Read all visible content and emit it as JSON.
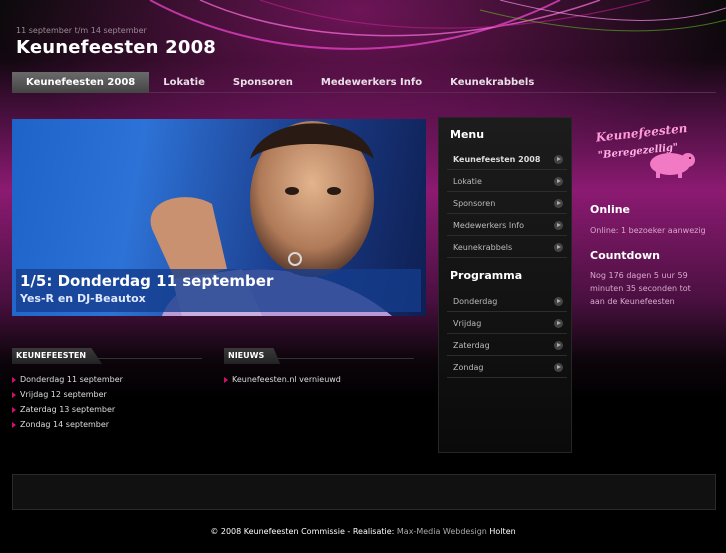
{
  "header": {
    "date_range": "11 september t/m 14 september",
    "title": "Keunefeesten 2008"
  },
  "nav": {
    "tabs": [
      {
        "label": "Keunefeesten 2008",
        "active": true
      },
      {
        "label": "Lokatie"
      },
      {
        "label": "Sponsoren"
      },
      {
        "label": "Medewerkers Info"
      },
      {
        "label": "Keunekrabbels"
      }
    ]
  },
  "hero": {
    "title": "1/5: Donderdag 11 september",
    "subtitle": "Yes-R en DJ-Beautox"
  },
  "menu_panel": {
    "menu_title": "Menu",
    "menu_items": [
      "Keunefeesten 2008",
      "Lokatie",
      "Sponsoren",
      "Medewerkers Info",
      "Keunekrabbels"
    ],
    "program_title": "Programma",
    "program_items": [
      "Donderdag",
      "Vrijdag",
      "Zaterdag",
      "Zondag"
    ]
  },
  "sidebar": {
    "logo_line1": "Keunefeesten",
    "logo_line2": "\"Beregezellig\"",
    "online_heading": "Online",
    "online_text": "Online: 1 bezoeker aanwezig",
    "countdown_heading": "Countdown",
    "countdown_text": "Nog 176 dagen 5 uur 59 minuten 35 seconden tot aan de Keunefeesten"
  },
  "sections": {
    "keunefeesten": {
      "label": "KEUNEFEESTEN",
      "items": [
        "Donderdag 11 september",
        "Vrijdag 12 september",
        "Zaterdag 13 september",
        "Zondag 14 september"
      ]
    },
    "nieuws": {
      "label": "NIEUWS",
      "items": [
        "Keunefeesten.nl vernieuwd"
      ]
    }
  },
  "footer": {
    "copyright": "© 2008 Keunefeesten Commissie - Realisatie: ",
    "credit_link": "Max-Media Webdesign",
    "credit_suffix": " Holten"
  },
  "colors": {
    "accent_pink": "#d0106e",
    "hero_blue": "#1e63c8"
  }
}
